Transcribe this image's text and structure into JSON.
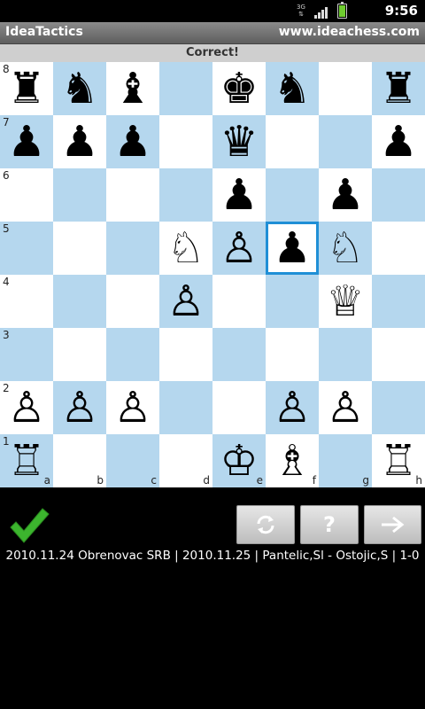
{
  "status_bar": {
    "network_label": "3G",
    "time": "9:56"
  },
  "title_bar": {
    "app_name": "IdeaTactics",
    "url": "www.ideachess.com"
  },
  "feedback": "Correct!",
  "board": {
    "ranks": [
      "8",
      "7",
      "6",
      "5",
      "4",
      "3",
      "2",
      "1"
    ],
    "files": [
      "a",
      "b",
      "c",
      "d",
      "e",
      "f",
      "g",
      "h"
    ],
    "colors": {
      "light": "#ffffff",
      "dark": "#b5d7ee",
      "highlight": "#1f8fd6"
    },
    "highlighted_square": "f5",
    "pieces": {
      "a8": "bR",
      "b8": "bN",
      "c8": "bB",
      "e8": "bK",
      "f8": "bN",
      "h8": "bR",
      "a7": "bP",
      "b7": "bP",
      "c7": "bP",
      "e7": "bQ",
      "h7": "bP",
      "e6": "bP",
      "g6": "bP",
      "d5": "wN",
      "e5": "wP",
      "f5": "bP",
      "g5": "wN",
      "d4": "wP",
      "g4": "wQ",
      "a2": "wP",
      "b2": "wP",
      "c2": "wP",
      "f2": "wP",
      "g2": "wP",
      "a1": "wR",
      "e1": "wK",
      "f1": "wB",
      "h1": "wR"
    }
  },
  "controls": {
    "result_icon": "checkmark-icon",
    "buttons": [
      {
        "name": "refresh-button",
        "icon": "refresh-icon"
      },
      {
        "name": "hint-button",
        "icon": "question-icon",
        "label": "?"
      },
      {
        "name": "next-button",
        "icon": "arrow-right-icon"
      }
    ]
  },
  "game_info": "2010.11.24 Obrenovac SRB | 2010.11.25 | Pantelic,Sl - Ostojic,S | 1-0"
}
